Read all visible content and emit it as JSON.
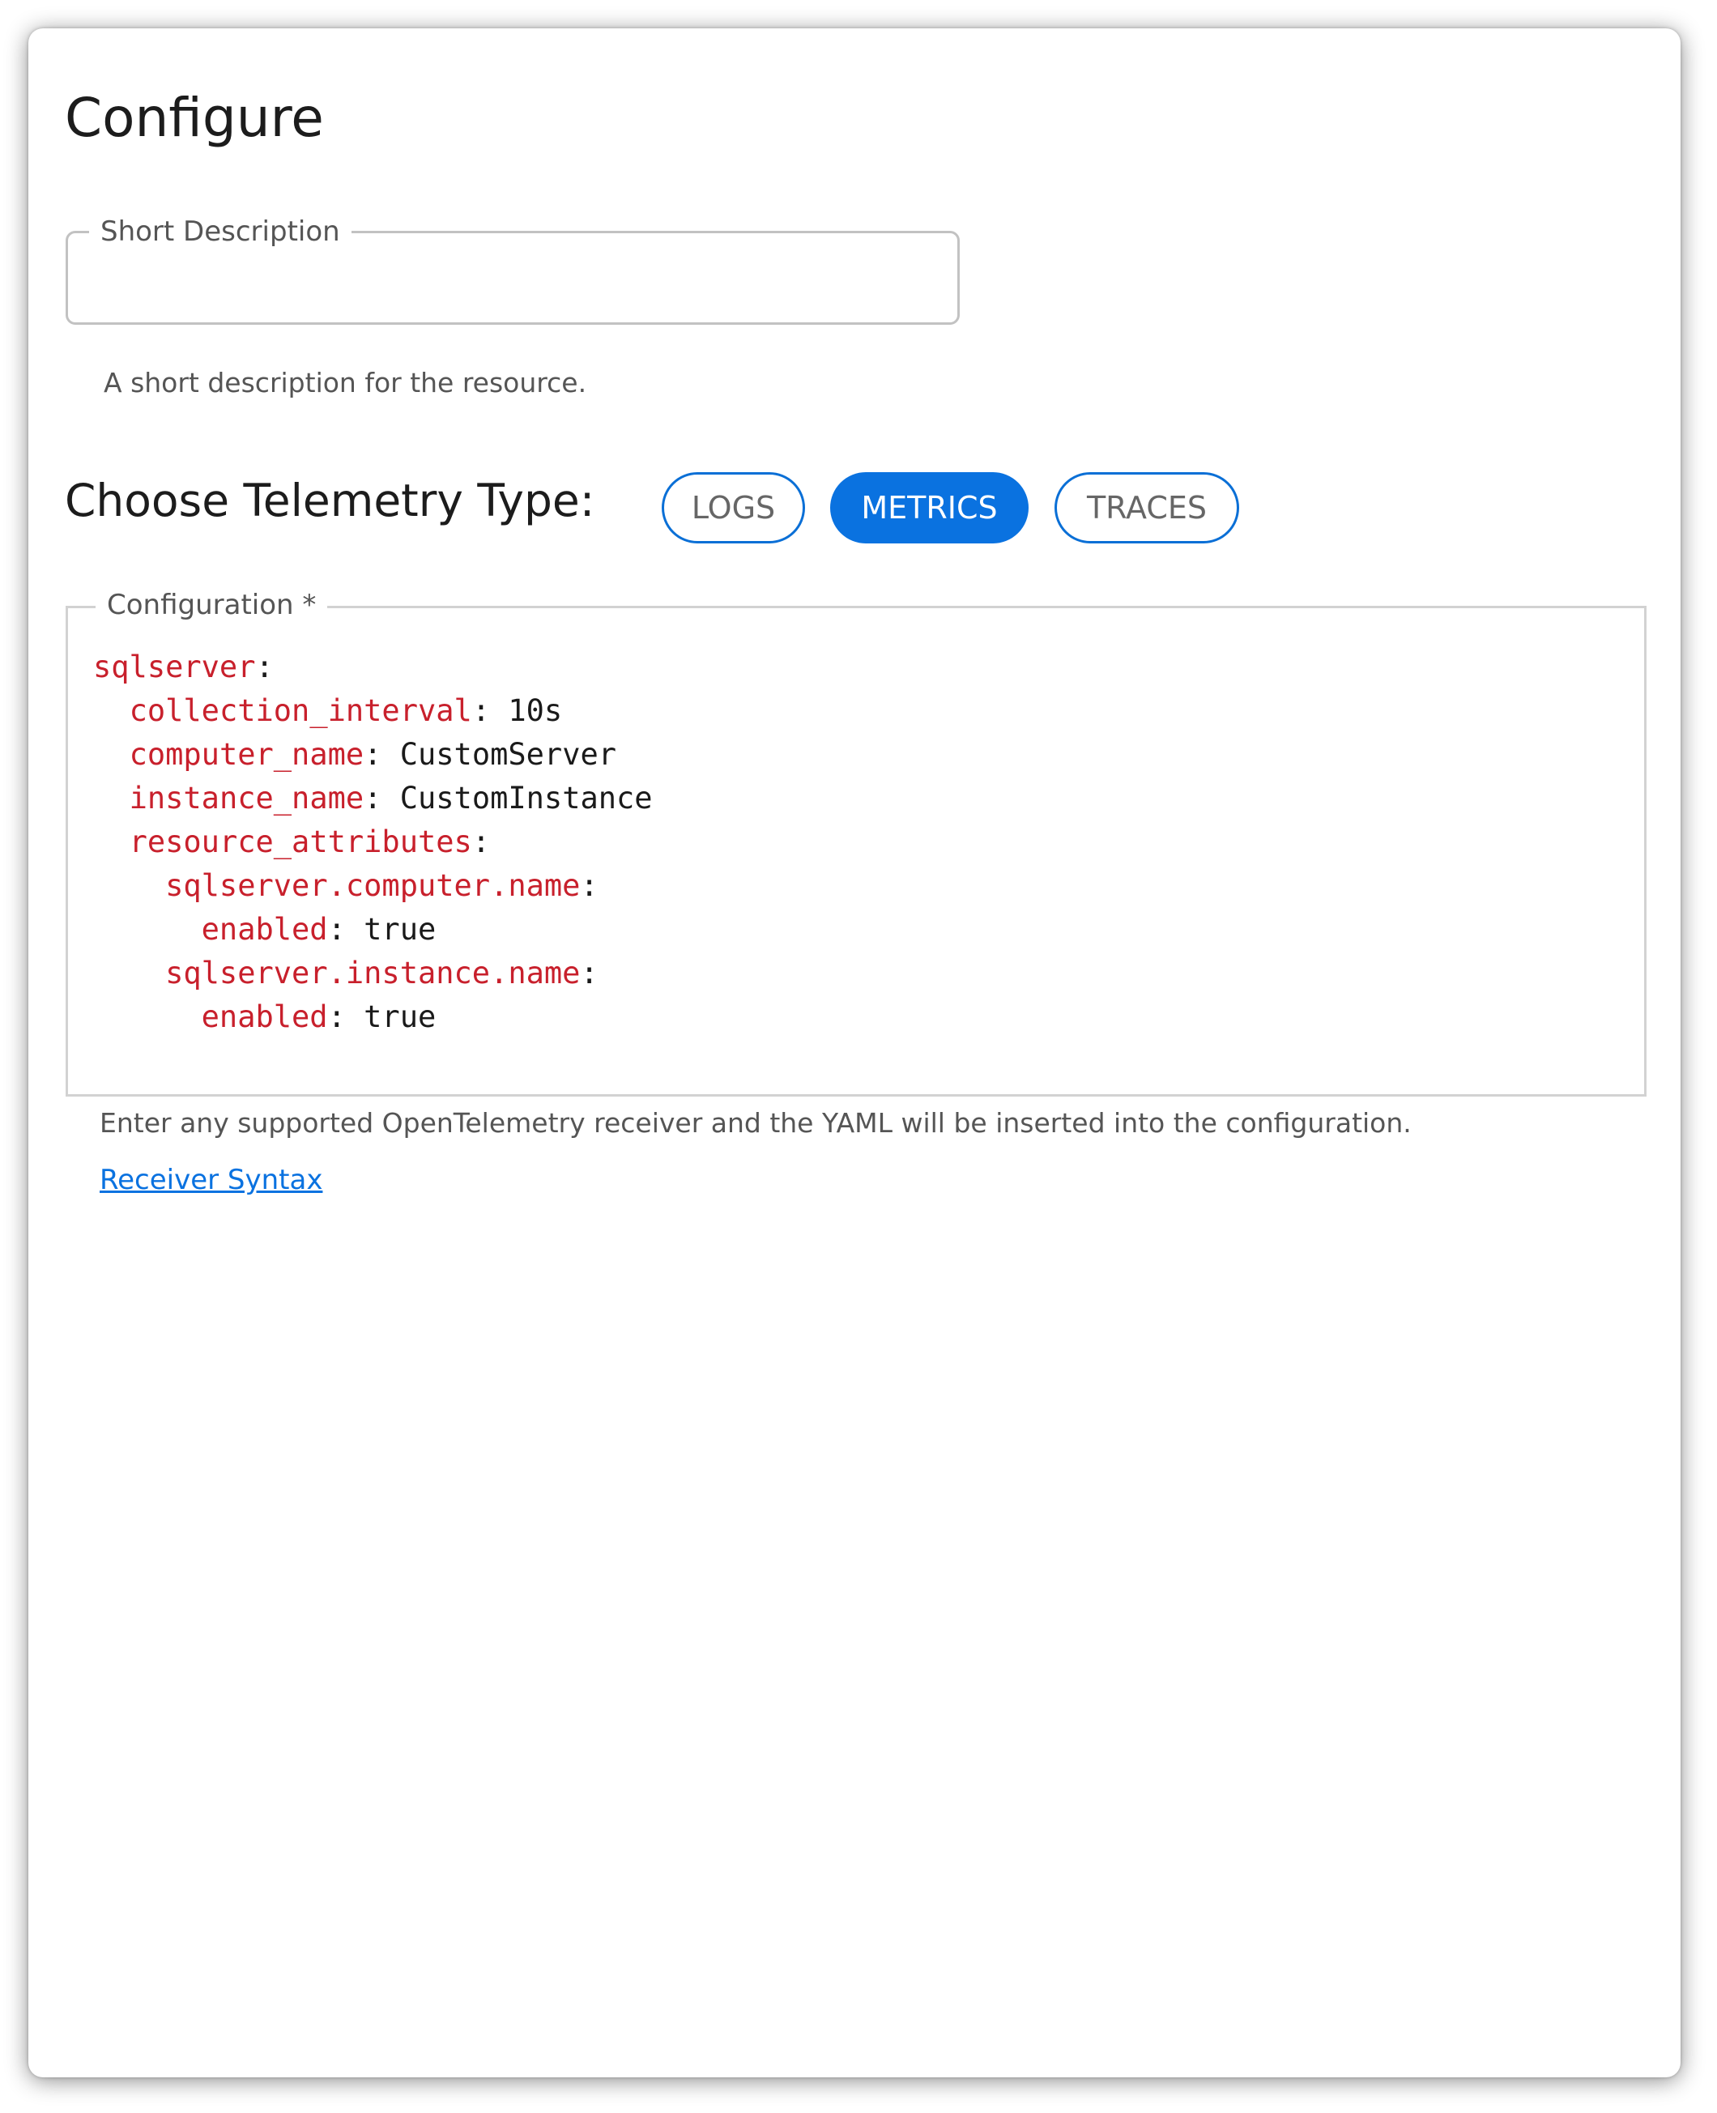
{
  "page": {
    "title": "Configure"
  },
  "short_description": {
    "label": "Short Description",
    "value": "",
    "placeholder": "",
    "helper": "A short description for the resource."
  },
  "telemetry": {
    "label": "Choose Telemetry Type:",
    "options": [
      {
        "label": "LOGS",
        "selected": false
      },
      {
        "label": "METRICS",
        "selected": true
      },
      {
        "label": "TRACES",
        "selected": false
      }
    ]
  },
  "configuration": {
    "label": "Configuration *",
    "lines": [
      {
        "indent": "",
        "key": "sqlserver",
        "value": ""
      },
      {
        "indent": "  ",
        "key": "collection_interval",
        "value": " 10s"
      },
      {
        "indent": "  ",
        "key": "computer_name",
        "value": " CustomServer"
      },
      {
        "indent": "  ",
        "key": "instance_name",
        "value": " CustomInstance"
      },
      {
        "indent": "  ",
        "key": "resource_attributes",
        "value": ""
      },
      {
        "indent": "    ",
        "key": "sqlserver.computer.name",
        "value": ""
      },
      {
        "indent": "      ",
        "key": "enabled",
        "value": " true"
      },
      {
        "indent": "    ",
        "key": "sqlserver.instance.name",
        "value": ""
      },
      {
        "indent": "      ",
        "key": "enabled",
        "value": " true"
      }
    ],
    "helper": "Enter any supported OpenTelemetry receiver and the YAML will be inserted into the configuration.",
    "link_label": "Receiver Syntax"
  },
  "colors": {
    "accent": "#0a72e0",
    "yaml_key": "#c8202c"
  }
}
